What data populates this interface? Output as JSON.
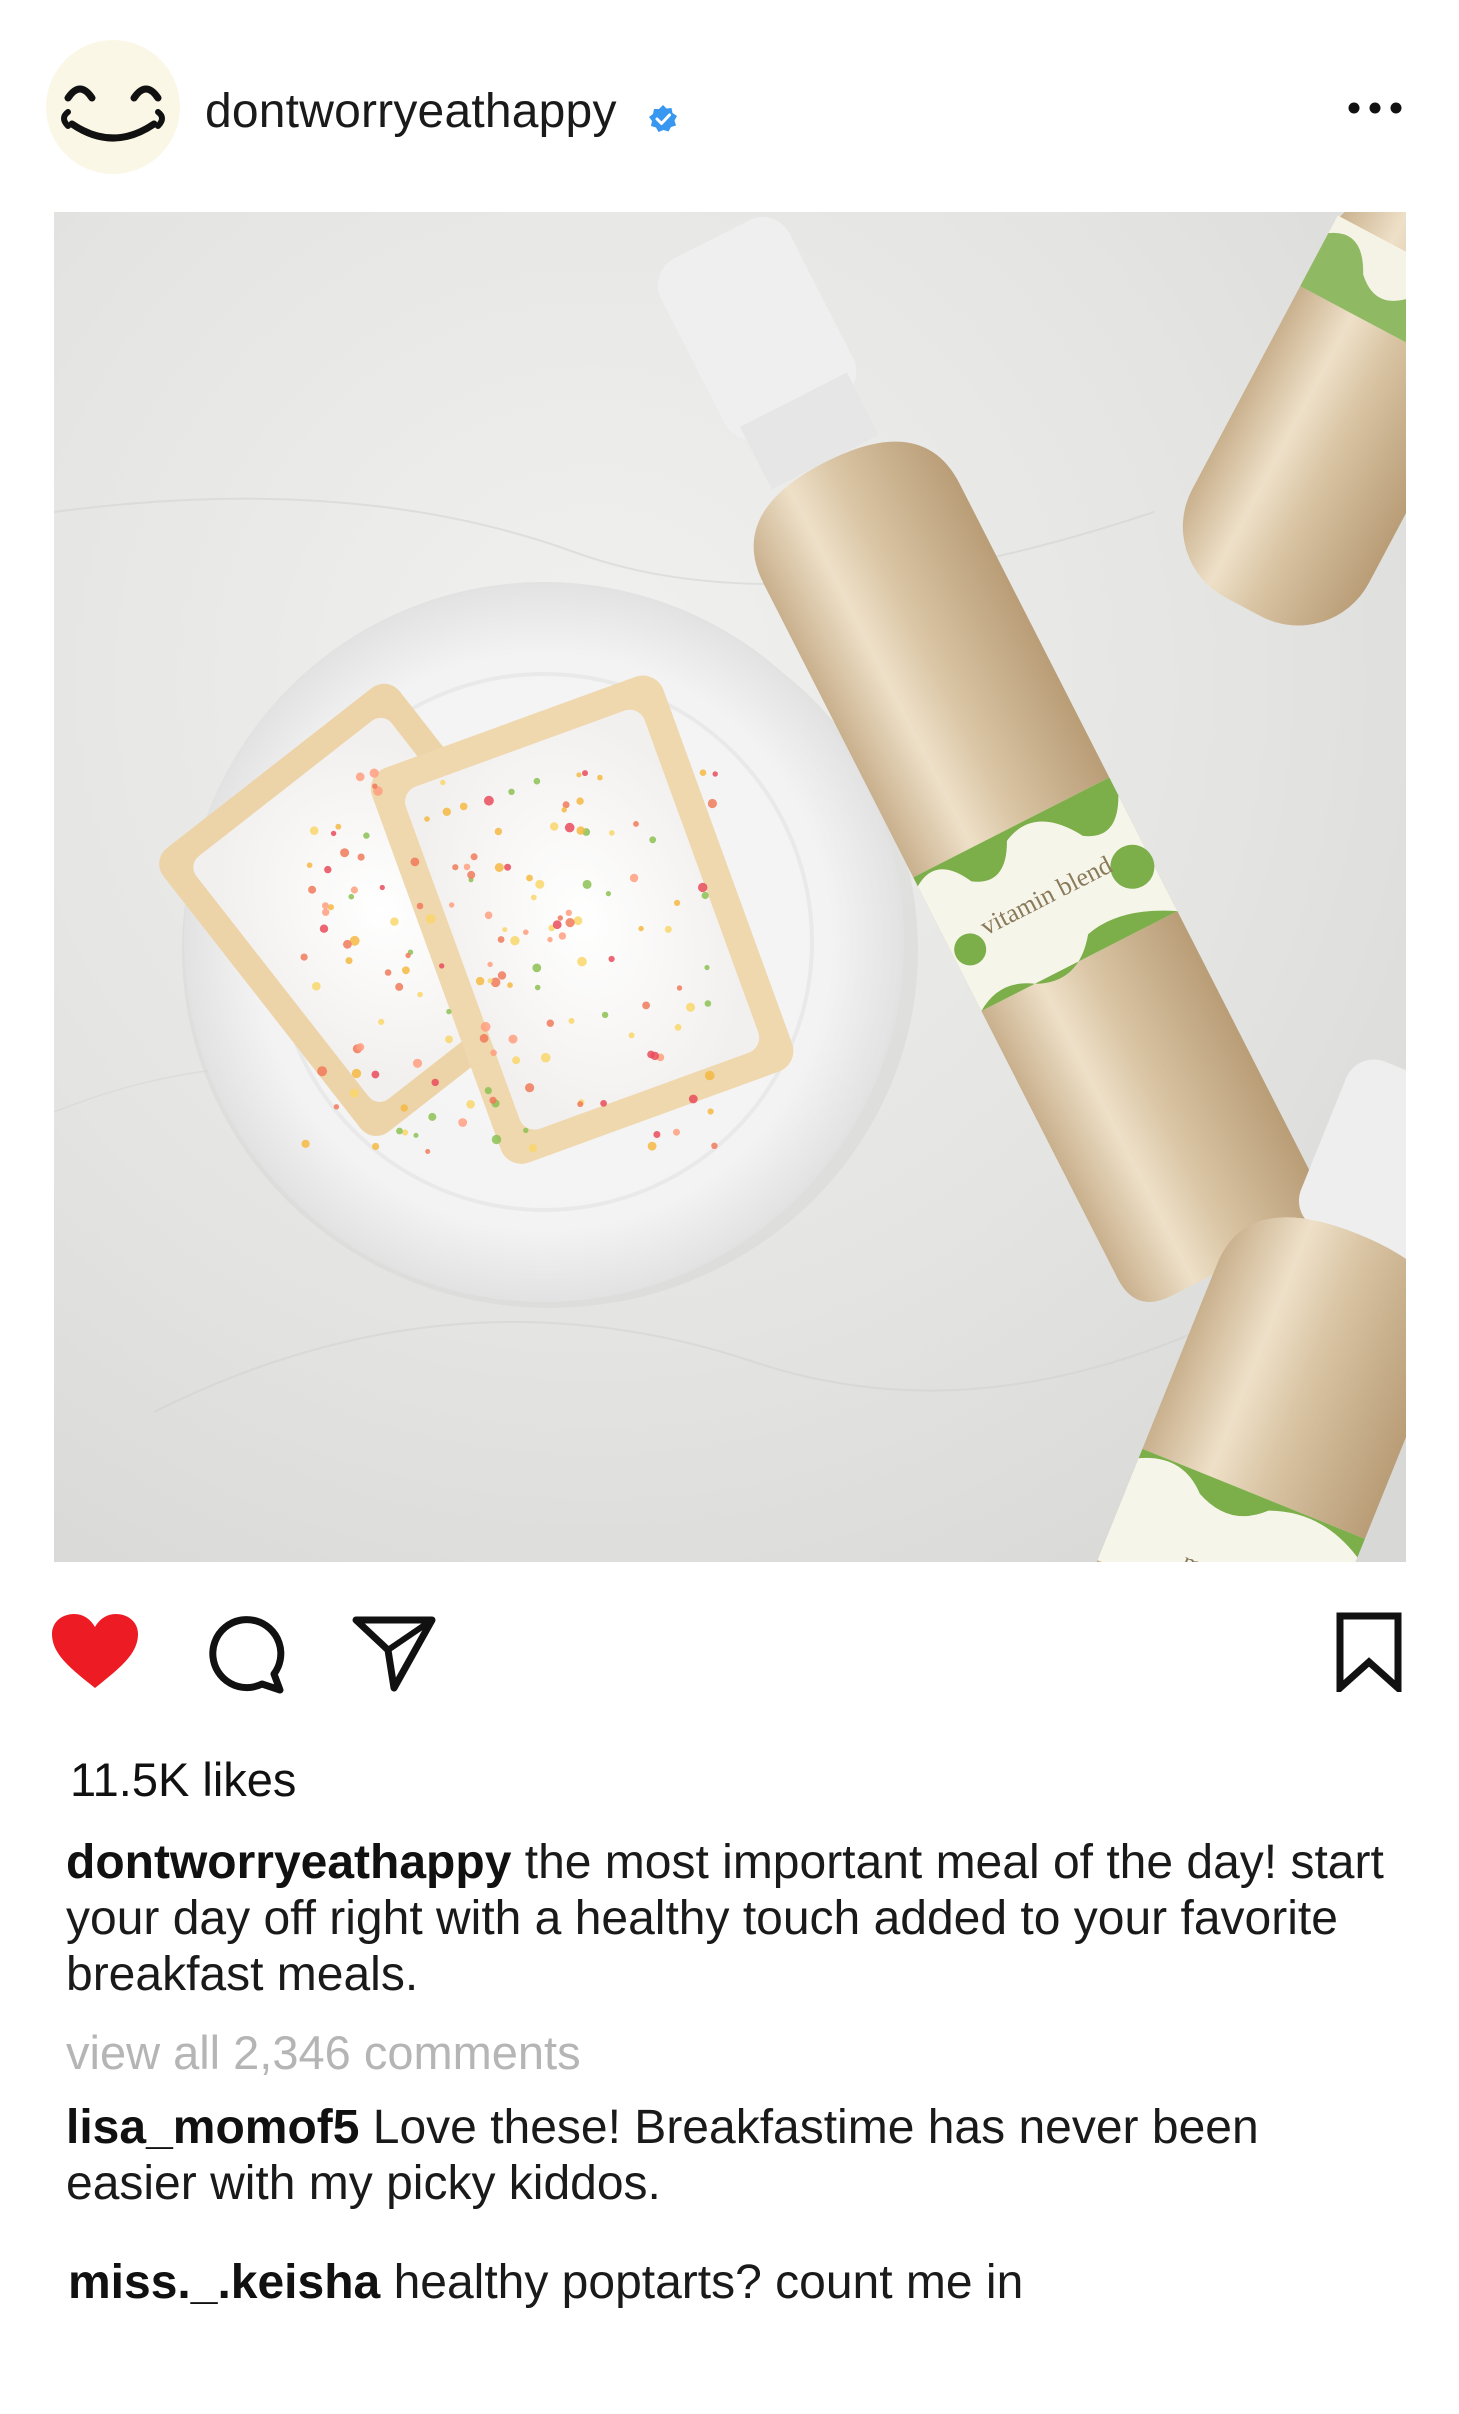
{
  "header": {
    "username": "dontworryeathappy",
    "verified": true,
    "avatar_icon": "smiling-face-icon",
    "more_icon": "more-options-icon"
  },
  "post": {
    "image_description_icon": "product-photo",
    "bottle_label_top": "vitamin blend",
    "bottle_label_bottom": "mac"
  },
  "actions": {
    "like_icon": "heart-icon",
    "liked": true,
    "like_color": "#ed1c24",
    "comment_icon": "comment-icon",
    "share_icon": "send-icon",
    "save_icon": "bookmark-icon"
  },
  "likes_label": "11.5K likes",
  "caption": {
    "author": "dontworryeathappy",
    "text": "the most important meal of the day! start your day off right with a healthy touch added to your favorite breakfast meals."
  },
  "view_comments_label": "view all 2,346 comments",
  "comments": [
    {
      "author": "lisa_momof5",
      "text": "Love these! Breakfastime has never been easier with my picky kiddos."
    },
    {
      "author": "miss._.keisha",
      "text": "healthy poptarts? count me in"
    }
  ],
  "colors": {
    "verified_badge": "#3897f0",
    "muted_text": "#b5b5b5",
    "label_green": "#7cae4a",
    "bottle_gold": "#d9c6a7"
  }
}
